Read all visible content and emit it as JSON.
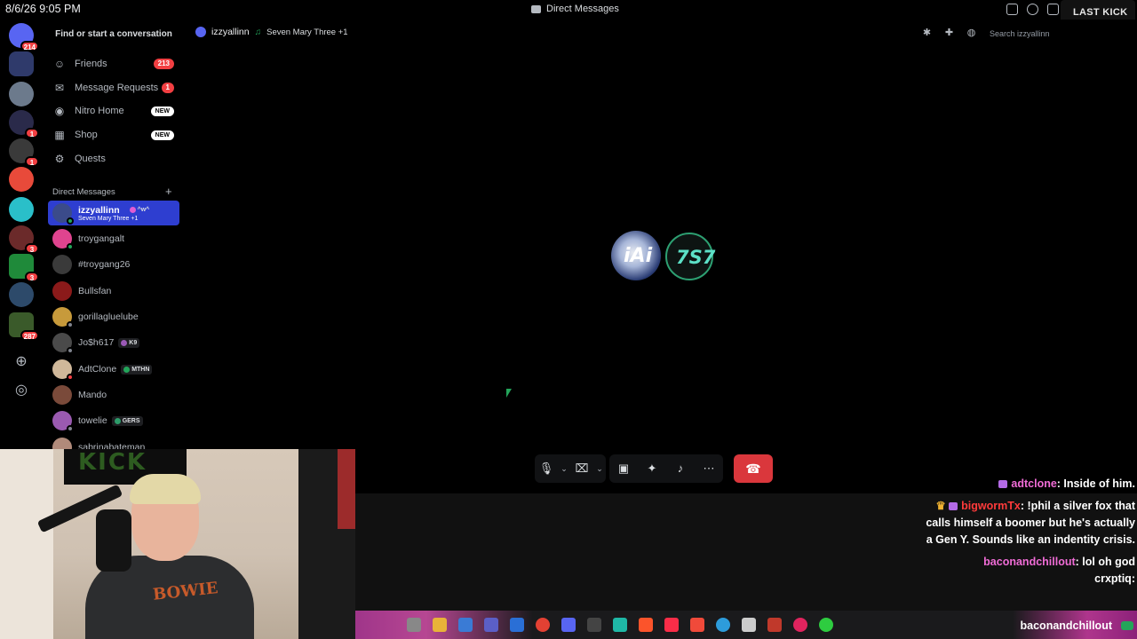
{
  "clock": "8/6/26 9:05 PM",
  "window": {
    "title": "Direct Messages"
  },
  "overlay": {
    "last_kick_title": "LAST KICK",
    "last_kick_name": "crxptiq"
  },
  "rail": {
    "home_badge": "214",
    "server_badges": [
      "1",
      "1",
      "3",
      "3",
      "287"
    ]
  },
  "sidebar": {
    "search_label": "Find or start a conversation",
    "nav": [
      {
        "label": "Friends",
        "badge": "213",
        "icon": "friends-icon"
      },
      {
        "label": "Message Requests",
        "badge": "1",
        "icon": "envelope-icon"
      },
      {
        "label": "Nitro Home",
        "badge": "NEW",
        "icon": "nitro-icon"
      },
      {
        "label": "Shop",
        "badge": "NEW",
        "icon": "shop-icon"
      },
      {
        "label": "Quests",
        "badge": "",
        "icon": "quest-icon"
      }
    ],
    "dm_header": "Direct Messages",
    "dms": [
      {
        "name": "izzyallinn",
        "tag": "^w^",
        "sub": "Seven Mary Three +1",
        "status": "on",
        "color": "#3b4b8a"
      },
      {
        "name": "troygangalt",
        "tag": "",
        "sub": "",
        "status": "on",
        "color": "#e0448f"
      },
      {
        "name": "#troygang26",
        "tag": "",
        "sub": "",
        "status": "off",
        "color": "#3a3a3a"
      },
      {
        "name": "Bullsfan",
        "tag": "",
        "sub": "",
        "status": "off",
        "color": "#8b1a1a"
      },
      {
        "name": "gorillagluelube",
        "tag": "",
        "sub": "",
        "status": "off",
        "color": "#c79a3b"
      },
      {
        "name": "Jo$h617",
        "tag": "K9",
        "sub": "",
        "status": "off",
        "color": "#4a4a4a"
      },
      {
        "name": "AdtClone",
        "tag": "MTHN",
        "sub": "",
        "status": "dnd",
        "color": "#d0b89a"
      },
      {
        "name": "Mando",
        "tag": "",
        "sub": "",
        "status": "off",
        "color": "#7a4a3a"
      },
      {
        "name": "towelie",
        "tag": "GERS",
        "sub": "",
        "status": "off",
        "color": "#9a5ab0"
      },
      {
        "name": "sabrinabateman",
        "tag": "",
        "sub": "",
        "status": "off",
        "color": "#b08a7a"
      }
    ]
  },
  "main": {
    "channel_name": "izzyallinn",
    "activity": "Seven Mary Three +1",
    "search_placeholder": "Search izzyallinn",
    "call_avatars": [
      "iAi",
      "7S7"
    ]
  },
  "chat": [
    {
      "user": "adtclone",
      "text": ": Inside of him.",
      "color": "pink",
      "crown": false
    },
    {
      "user": "bigwormTx",
      "text": ": !phil a silver fox that calls himself a boomer but he's actually a Gen Y. Sounds like an indentity crisis.",
      "color": "red",
      "crown": true
    },
    {
      "user": "baconandchillout",
      "text": ": lol oh god",
      "color": "pink",
      "crown": false
    },
    {
      "user": "crxptiq",
      "text": ":",
      "color": "white",
      "crown": false
    }
  ],
  "taskbar": {
    "follower": "baconandchillout",
    "time": "9:05 PM"
  }
}
